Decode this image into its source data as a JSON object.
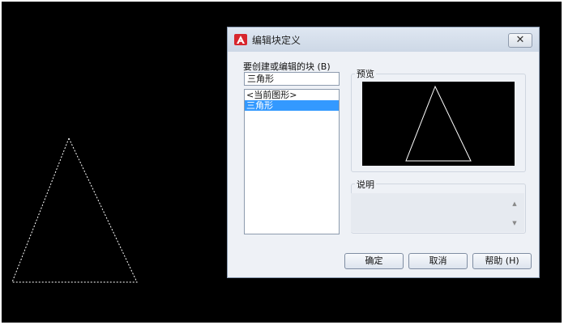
{
  "dialog": {
    "title": "编辑块定义",
    "close_glyph": "✕",
    "name_label": "要创建或编辑的块 (B)",
    "name_value": "三角形",
    "list_items": [
      "<当前图形>",
      "三角形"
    ],
    "selected_index": 1,
    "preview_label": "预览",
    "description_label": "说明",
    "buttons": {
      "ok": "确定",
      "cancel": "取消",
      "help": "帮助 (H)"
    }
  },
  "icons": {
    "app": "autocad-logo-icon",
    "close": "close-icon",
    "scroll_up": "scroll-up-icon",
    "scroll_down": "scroll-down-icon"
  },
  "colors": {
    "canvas_bg": "#000000",
    "triangle_dashed": "#ffffff",
    "selection": "#3399ff",
    "app_icon": "#d7262d"
  }
}
